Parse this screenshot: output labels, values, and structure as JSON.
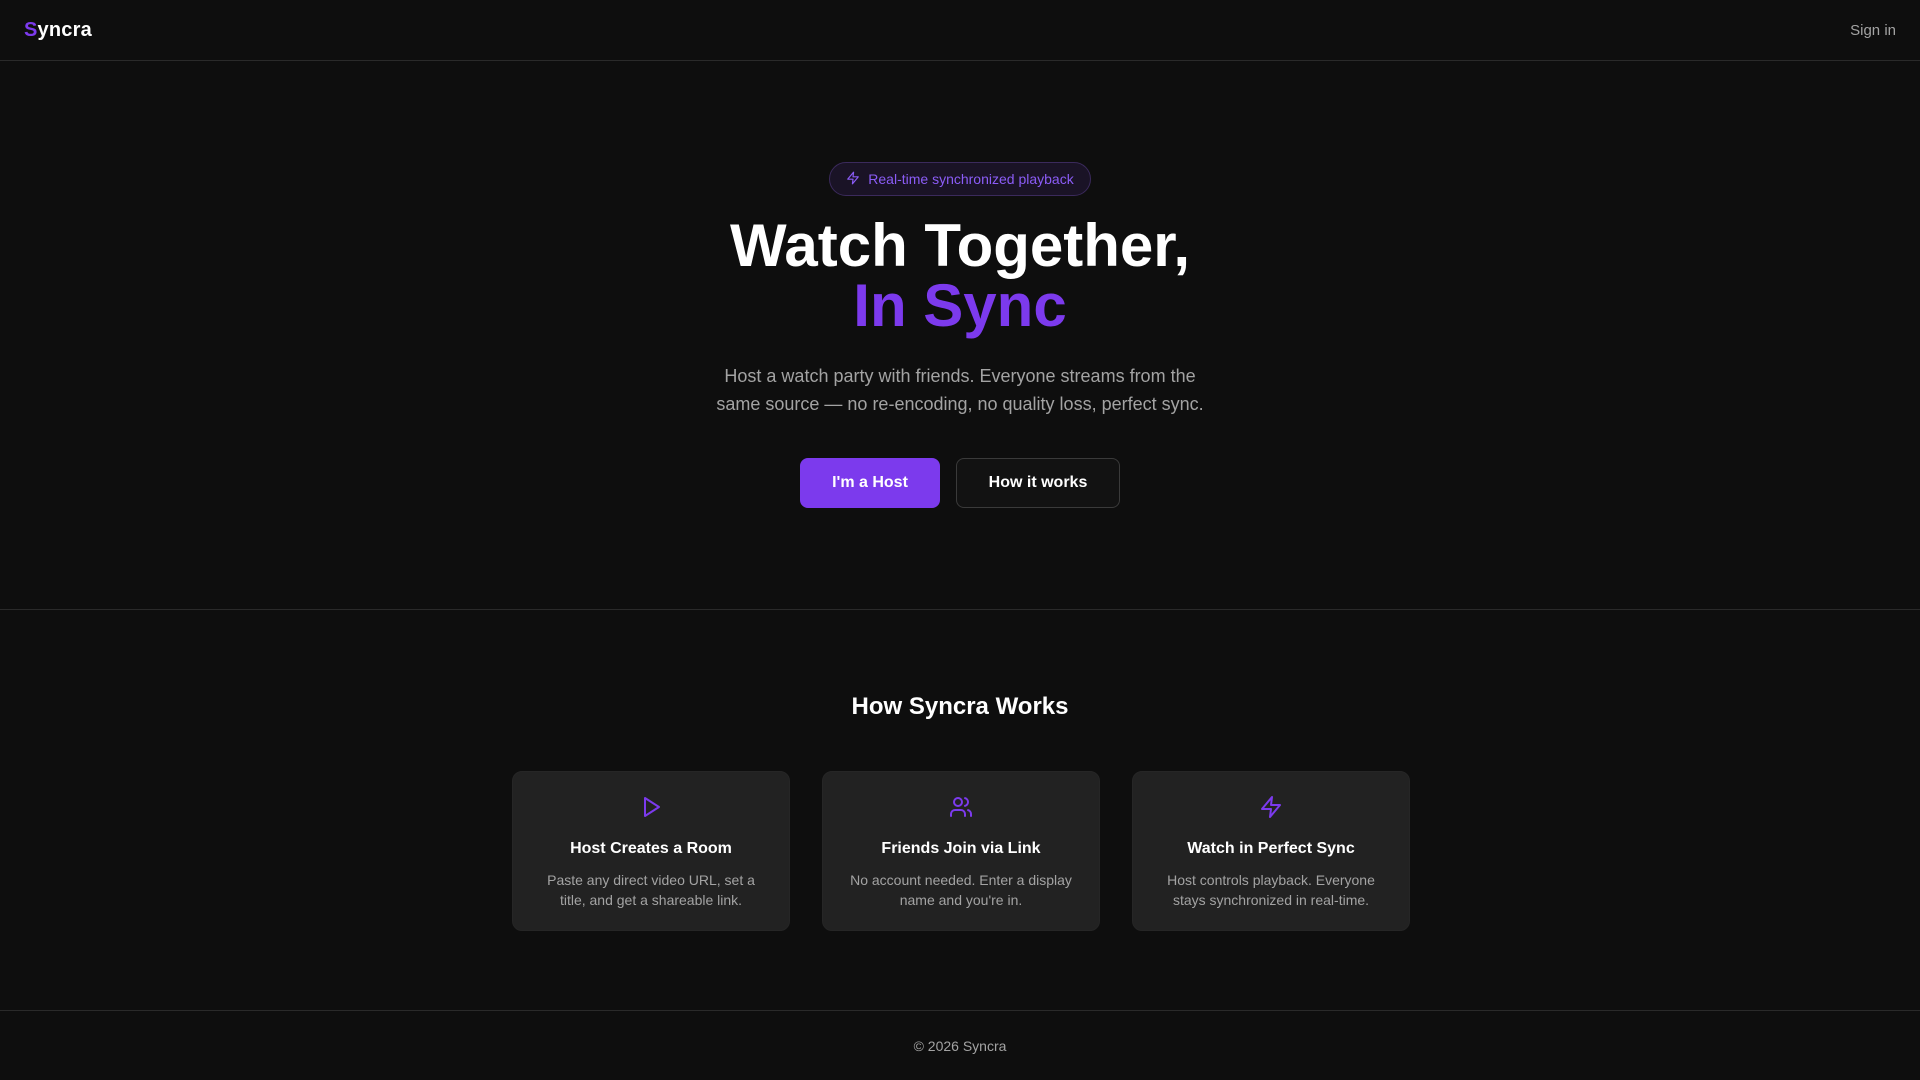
{
  "header": {
    "logo_first": "S",
    "logo_rest": "yncra",
    "signin_label": "Sign in"
  },
  "hero": {
    "badge_icon": "lightning-icon",
    "badge_text": "Real-time synchronized playback",
    "title_line1": "Watch Together,",
    "title_line2": "In Sync",
    "subtitle": "Host a watch party with friends. Everyone streams from the same source — no re-encoding, no quality loss, perfect sync.",
    "primary_button": "I'm a Host",
    "secondary_button": "How it works"
  },
  "how": {
    "title": "How Syncra Works",
    "cards": [
      {
        "icon": "play-icon",
        "title": "Host Creates a Room",
        "desc": "Paste any direct video URL, set a title, and get a shareable link."
      },
      {
        "icon": "users-icon",
        "title": "Friends Join via Link",
        "desc": "No account needed. Enter a display name and you're in."
      },
      {
        "icon": "lightning-icon",
        "title": "Watch in Perfect Sync",
        "desc": "Host controls playback. Everyone stays synchronized in real-time."
      }
    ]
  },
  "footer": {
    "text": "© 2026 Syncra"
  },
  "colors": {
    "background": "#0e0e0e",
    "accent": "#7c3aed",
    "card_bg": "#222222",
    "muted_text": "#a3a3a3",
    "border": "#2a2a2a"
  }
}
